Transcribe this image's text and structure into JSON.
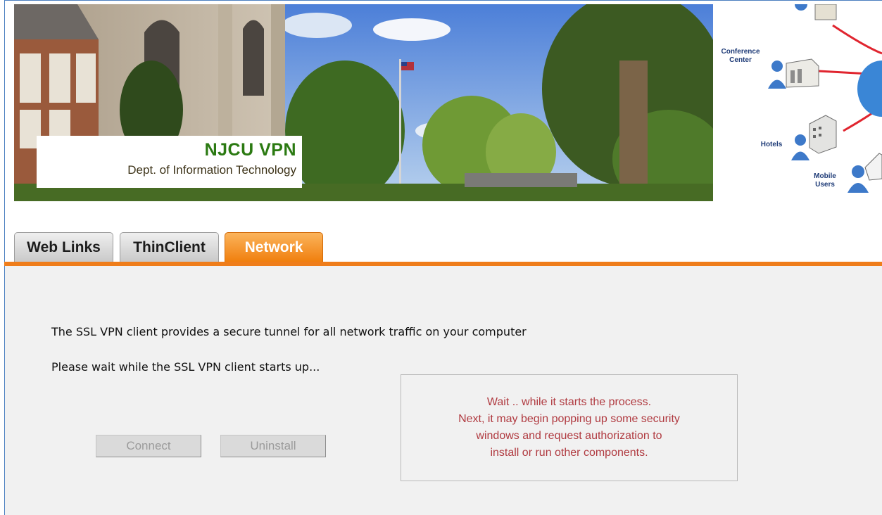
{
  "banner": {
    "title": "NJCU VPN",
    "subtitle": "Dept. of Information Technology"
  },
  "diagram": {
    "labels": [
      "Conference Center",
      "Hotels",
      "Mobile Users"
    ],
    "line_color": "#e0252f",
    "person_color": "#3d79c9"
  },
  "tabs": [
    {
      "label": "Web Links",
      "active": false
    },
    {
      "label": "ThinClient",
      "active": false
    },
    {
      "label": "Network",
      "active": true
    }
  ],
  "colors": {
    "accent": "#ef7d1a",
    "logo_green": "#2b7a12",
    "notice_text": "#b03a40"
  },
  "content": {
    "description": "The SSL VPN client provides a secure tunnel for all network traffic on your computer",
    "status": "Please wait while the SSL VPN client starts up...",
    "buttons": {
      "connect": "Connect",
      "uninstall": "Uninstall"
    },
    "notice": [
      "Wait .. while it starts the process.",
      "Next, it may begin popping up some security",
      "windows and request authorization to",
      "install or run other components."
    ]
  }
}
